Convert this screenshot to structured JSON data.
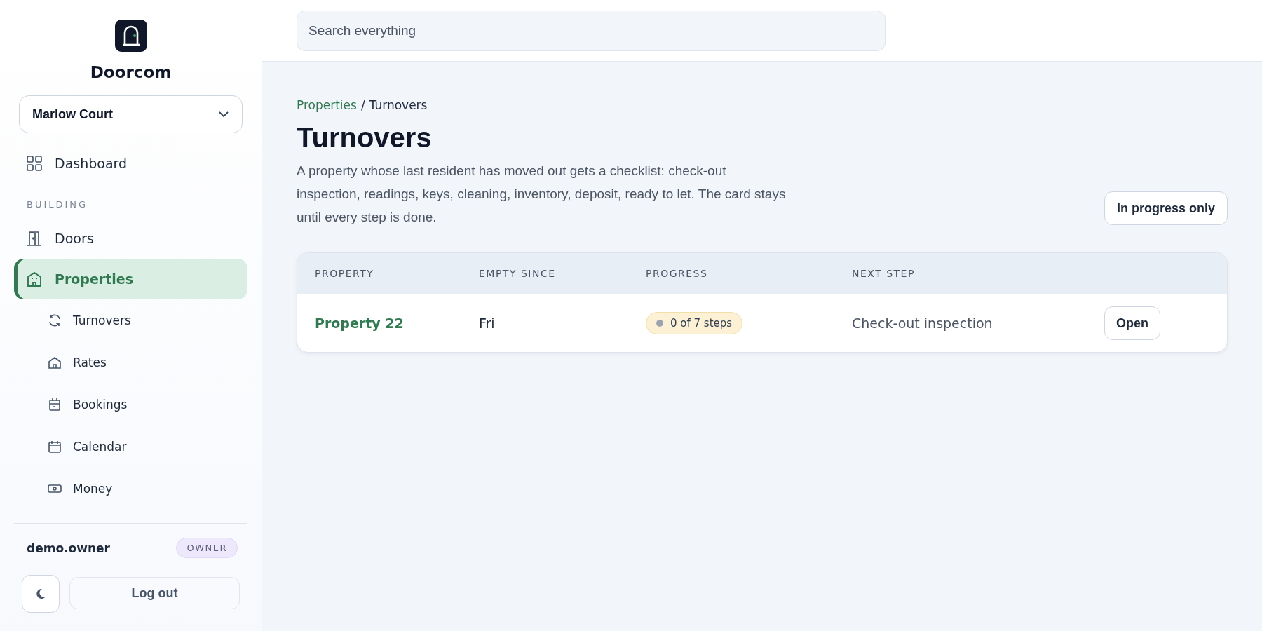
{
  "brand": {
    "name": "Doorcom"
  },
  "site_picker": {
    "value": "Marlow Court"
  },
  "nav": [
    {
      "label": "Dashboard",
      "selected": false
    },
    {
      "section": "BUILDING"
    },
    {
      "label": "Doors",
      "selected": false
    },
    {
      "label": "Properties",
      "selected": true,
      "children": [
        {
          "label": "Turnovers",
          "selected": false
        },
        {
          "label": "Rates",
          "selected": false
        },
        {
          "label": "Bookings",
          "selected": false
        },
        {
          "label": "Calendar",
          "selected": false
        },
        {
          "label": "Money",
          "selected": false
        }
      ]
    }
  ],
  "user": {
    "name": "demo.owner",
    "role": "OWNER"
  },
  "logout": "Log out",
  "search": {
    "placeholder": "Search everything"
  },
  "breadcrumb": {
    "separator": "/",
    "items": [
      {
        "label": "Properties",
        "link": true
      },
      {
        "label": "Turnovers",
        "link": false
      }
    ]
  },
  "title": "Turnovers",
  "description": "A property whose last resident has moved out gets a checklist: check-out inspection, readings, keys, cleaning, inventory, deposit, ready to let. The card stays until every step is done.",
  "filter_button": "In progress only",
  "table": {
    "columns": [
      "PROPERTY",
      "EMPTY SINCE",
      "PROGRESS",
      "NEXT STEP"
    ],
    "rows": [
      {
        "property": "Property 22",
        "empty_since": "Fri",
        "progress": "0 of 7 steps",
        "next_step": "Check-out inspection",
        "action": "Open"
      }
    ]
  }
}
